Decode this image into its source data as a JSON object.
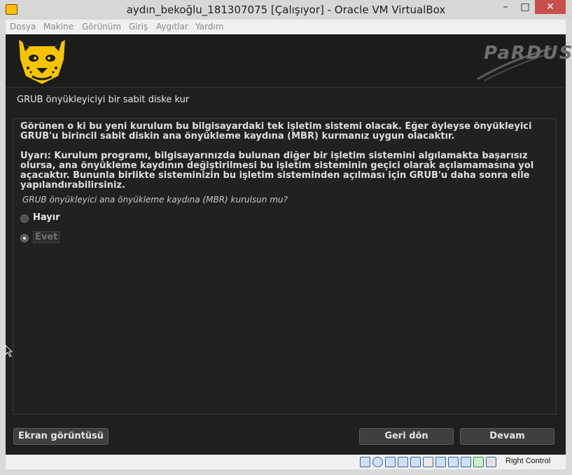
{
  "window": {
    "title": "aydın_bekoğlu_181307075 [Çalışıyor] - Oracle VM VirtualBox",
    "minimize_glyph": "–",
    "maximize_glyph": "□",
    "close_glyph": "✕"
  },
  "menu": [
    "Dosya",
    "Makine",
    "Görünüm",
    "Giriş",
    "Aygıtlar",
    "Yardım"
  ],
  "installer": {
    "brand": "PaRDUS",
    "step_title": "GRUB önyükleyiciyi bir sabit diske kur",
    "paragraph1": "Görünen o ki bu yeni kurulum bu bilgisayardaki tek işletim sistemi olacak. Eğer öyleyse önyükleyici GRUB'u birincil sabit diskin ana önyükleme kaydına (MBR) kurmanız uygun olacaktır.",
    "paragraph2": "Uyarı: Kurulum programı, bilgisayarınızda bulunan diğer bir işletim sistemini algılamakta başarısız olursa, ana önyükleme kaydının değiştirilmesi bu işletim sisteminin geçici olarak açılamamasına yol açacaktır. Bununla birlikte sisteminizin bu işletim sisteminden açılması için GRUB'u daha sonra elle yapılandırabilirsiniz.",
    "question": "GRUB önyükleyici ana önyükleme kaydına (MBR) kurulsun mu?",
    "options": [
      {
        "label": "Hayır",
        "selected": false
      },
      {
        "label": "Evet",
        "selected": true
      }
    ],
    "buttons": {
      "screenshot": "Ekran görüntüsü",
      "back": "Geri dön",
      "next": "Devam"
    }
  },
  "status_bar": {
    "icons": [
      "hard-disk-icon",
      "optical-drive-icon",
      "audio-icon",
      "network-icon",
      "usb-icon",
      "shared-folders-icon",
      "display-icon",
      "video-capture-icon",
      "virtualization-icon",
      "mouse-integration-icon",
      "keyboard-capture-icon"
    ],
    "host_key": "Right Control"
  },
  "colors": {
    "vm_background": "#1e201e",
    "titlebar": "#d7d7d7",
    "close_button": "#c7504c",
    "logo_yellow": "#f5c400"
  }
}
